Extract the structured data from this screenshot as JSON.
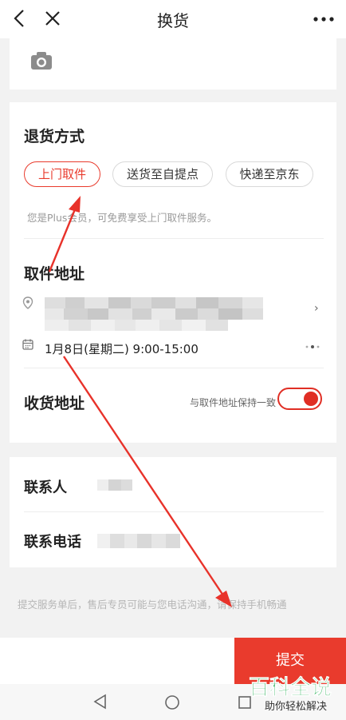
{
  "header": {
    "title": "换货"
  },
  "return_method": {
    "title": "退货方式",
    "options": [
      "上门取件",
      "送货至自提点",
      "快递至京东"
    ],
    "selected": 0,
    "hint": "您是Plus会员，可免费享受上门取件服务。"
  },
  "pickup_address": {
    "title": "取件地址",
    "time": "1月8日(星期二) 9:00-15:00"
  },
  "delivery_address": {
    "title": "收货地址",
    "sync_label": "与取件地址保持一致",
    "toggle_on": true
  },
  "contact": {
    "name_label": "联系人",
    "phone_label": "联系电话"
  },
  "note": "提交服务单后，售后专员可能与您电话沟通，请保持手机畅通",
  "submit_label": "提交",
  "watermark": {
    "title": "百科全说",
    "subtitle": "助你轻松解决"
  },
  "colors": {
    "accent": "#e93b2d",
    "toggle": "#e02e24",
    "watermark": "#1aa84a"
  }
}
